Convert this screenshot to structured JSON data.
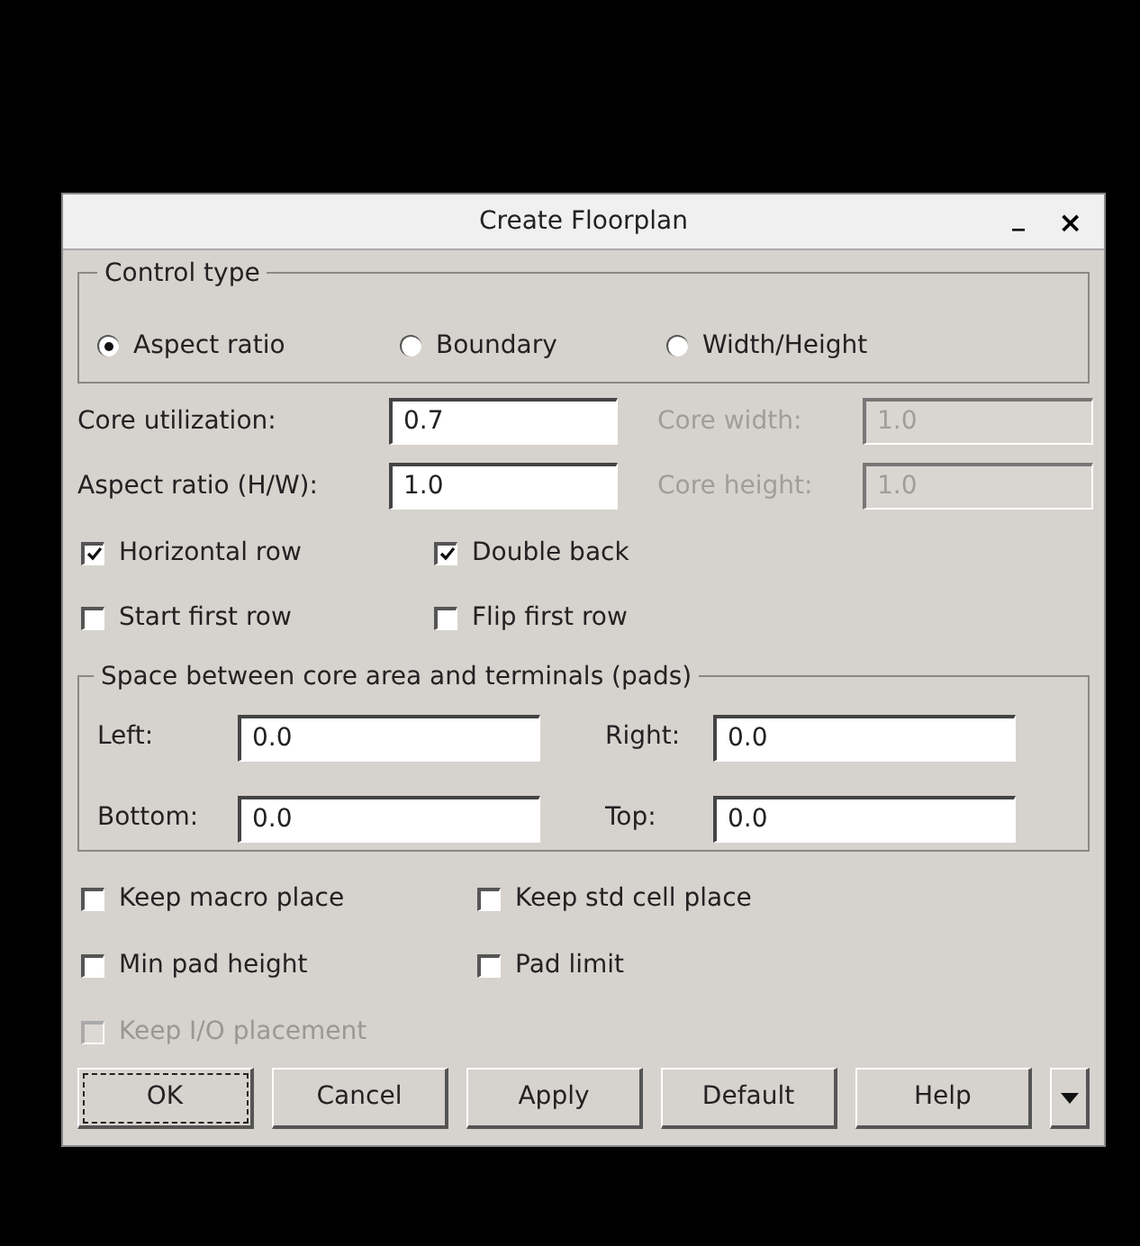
{
  "window": {
    "title": "Create Floorplan",
    "minimize": "_",
    "close": "×"
  },
  "control_type": {
    "title": "Control type",
    "options": [
      {
        "label": "Aspect ratio",
        "selected": true
      },
      {
        "label": "Boundary",
        "selected": false
      },
      {
        "label": "Width/Height",
        "selected": false
      }
    ]
  },
  "fields": [
    {
      "label": "Core utilization:",
      "value": "0.7",
      "disabled": false
    },
    {
      "label": "Core width:",
      "value": "1.0",
      "disabled": true
    },
    {
      "label": "Aspect ratio (H/W):",
      "value": "1.0",
      "disabled": false
    },
    {
      "label": "Core height:",
      "value": "1.0",
      "disabled": true
    }
  ],
  "row_options": [
    {
      "label": "Horizontal row",
      "checked": true,
      "disabled": false
    },
    {
      "label": "Double back",
      "checked": true,
      "disabled": false
    },
    {
      "label": "Start first row",
      "checked": false,
      "disabled": false
    },
    {
      "label": "Flip first row",
      "checked": false,
      "disabled": false
    }
  ],
  "spacing": {
    "title": "Space between core area and terminals (pads)",
    "fields": [
      {
        "label": "Left:",
        "value": "0.0"
      },
      {
        "label": "Right:",
        "value": "0.0"
      },
      {
        "label": "Bottom:",
        "value": "0.0"
      },
      {
        "label": "Top:",
        "value": "0.0"
      }
    ]
  },
  "placement_options": [
    {
      "label": "Keep macro place",
      "checked": false,
      "disabled": false
    },
    {
      "label": "Keep std cell place",
      "checked": false,
      "disabled": false
    },
    {
      "label": "Min pad height",
      "checked": false,
      "disabled": false
    },
    {
      "label": "Pad limit",
      "checked": false,
      "disabled": false
    },
    {
      "label": "Keep I/O placement",
      "checked": false,
      "disabled": true
    }
  ],
  "buttons": [
    {
      "label": "OK",
      "selected": true
    },
    {
      "label": "Cancel",
      "selected": false
    },
    {
      "label": "Apply",
      "selected": false
    },
    {
      "label": "Default",
      "selected": false
    },
    {
      "label": "Help",
      "selected": false
    }
  ]
}
